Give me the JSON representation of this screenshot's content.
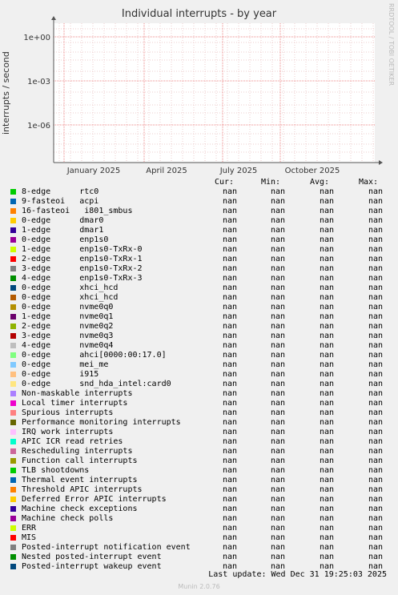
{
  "title": "Individual interrupts - by year",
  "side_label": "RRDTOOL / TOBI OETIKER",
  "footer": "Munin 2.0.76",
  "last_update": "Last update:  Wed Dec 31 19:25:03 2025",
  "columns": [
    "Cur:",
    "Min:",
    "Avg:",
    "Max:"
  ],
  "chart_data": {
    "type": "line",
    "title": "Individual interrupts - by year",
    "ylabel": "interrupts / second",
    "xlabel": "",
    "yscale": "log",
    "yticks": [
      "1e+00",
      "1e-03",
      "1e-06"
    ],
    "xticks": [
      "January 2025",
      "April 2025",
      "July 2025",
      "October 2025"
    ],
    "grid": true,
    "series_values": "nan"
  },
  "series": [
    {
      "label": "8-edge      rtc0",
      "color": "#00cc00",
      "cur": "nan",
      "min": "nan",
      "avg": "nan",
      "max": "nan"
    },
    {
      "label": "9-fasteoi   acpi",
      "color": "#0066b3",
      "cur": "nan",
      "min": "nan",
      "avg": "nan",
      "max": "nan"
    },
    {
      "label": "16-fasteoi   i801_smbus",
      "color": "#ff8000",
      "cur": "nan",
      "min": "nan",
      "avg": "nan",
      "max": "nan"
    },
    {
      "label": "0-edge      dmar0",
      "color": "#ffcc00",
      "cur": "nan",
      "min": "nan",
      "avg": "nan",
      "max": "nan"
    },
    {
      "label": "1-edge      dmar1",
      "color": "#330099",
      "cur": "nan",
      "min": "nan",
      "avg": "nan",
      "max": "nan"
    },
    {
      "label": "0-edge      enp1s0",
      "color": "#990099",
      "cur": "nan",
      "min": "nan",
      "avg": "nan",
      "max": "nan"
    },
    {
      "label": "1-edge      enp1s0-TxRx-0",
      "color": "#ccff00",
      "cur": "nan",
      "min": "nan",
      "avg": "nan",
      "max": "nan"
    },
    {
      "label": "2-edge      enp1s0-TxRx-1",
      "color": "#ff0000",
      "cur": "nan",
      "min": "nan",
      "avg": "nan",
      "max": "nan"
    },
    {
      "label": "3-edge      enp1s0-TxRx-2",
      "color": "#808080",
      "cur": "nan",
      "min": "nan",
      "avg": "nan",
      "max": "nan"
    },
    {
      "label": "4-edge      enp1s0-TxRx-3",
      "color": "#008f00",
      "cur": "nan",
      "min": "nan",
      "avg": "nan",
      "max": "nan"
    },
    {
      "label": "0-edge      xhci_hcd",
      "color": "#00487d",
      "cur": "nan",
      "min": "nan",
      "avg": "nan",
      "max": "nan"
    },
    {
      "label": "0-edge      xhci_hcd",
      "color": "#b35a00",
      "cur": "nan",
      "min": "nan",
      "avg": "nan",
      "max": "nan"
    },
    {
      "label": "0-edge      nvme0q0",
      "color": "#b38f00",
      "cur": "nan",
      "min": "nan",
      "avg": "nan",
      "max": "nan"
    },
    {
      "label": "1-edge      nvme0q1",
      "color": "#6b006b",
      "cur": "nan",
      "min": "nan",
      "avg": "nan",
      "max": "nan"
    },
    {
      "label": "2-edge      nvme0q2",
      "color": "#8fb300",
      "cur": "nan",
      "min": "nan",
      "avg": "nan",
      "max": "nan"
    },
    {
      "label": "3-edge      nvme0q3",
      "color": "#b30000",
      "cur": "nan",
      "min": "nan",
      "avg": "nan",
      "max": "nan"
    },
    {
      "label": "4-edge      nvme0q4",
      "color": "#bebebe",
      "cur": "nan",
      "min": "nan",
      "avg": "nan",
      "max": "nan"
    },
    {
      "label": "0-edge      ahci[0000:00:17.0]",
      "color": "#80ff80",
      "cur": "nan",
      "min": "nan",
      "avg": "nan",
      "max": "nan"
    },
    {
      "label": "0-edge      mei_me",
      "color": "#80c9ff",
      "cur": "nan",
      "min": "nan",
      "avg": "nan",
      "max": "nan"
    },
    {
      "label": "0-edge      i915",
      "color": "#ffc080",
      "cur": "nan",
      "min": "nan",
      "avg": "nan",
      "max": "nan"
    },
    {
      "label": "0-edge      snd_hda_intel:card0",
      "color": "#ffe680",
      "cur": "nan",
      "min": "nan",
      "avg": "nan",
      "max": "nan"
    },
    {
      "label": "Non-maskable interrupts",
      "color": "#aa80ff",
      "cur": "nan",
      "min": "nan",
      "avg": "nan",
      "max": "nan"
    },
    {
      "label": "Local timer interrupts",
      "color": "#ee00cc",
      "cur": "nan",
      "min": "nan",
      "avg": "nan",
      "max": "nan"
    },
    {
      "label": "Spurious interrupts",
      "color": "#ff8080",
      "cur": "nan",
      "min": "nan",
      "avg": "nan",
      "max": "nan"
    },
    {
      "label": "Performance monitoring interrupts",
      "color": "#666600",
      "cur": "nan",
      "min": "nan",
      "avg": "nan",
      "max": "nan"
    },
    {
      "label": "IRQ work interrupts",
      "color": "#ffbfff",
      "cur": "nan",
      "min": "nan",
      "avg": "nan",
      "max": "nan"
    },
    {
      "label": "APIC ICR read retries",
      "color": "#00ffcc",
      "cur": "nan",
      "min": "nan",
      "avg": "nan",
      "max": "nan"
    },
    {
      "label": "Rescheduling interrupts",
      "color": "#cc6699",
      "cur": "nan",
      "min": "nan",
      "avg": "nan",
      "max": "nan"
    },
    {
      "label": "Function call interrupts",
      "color": "#999900",
      "cur": "nan",
      "min": "nan",
      "avg": "nan",
      "max": "nan"
    },
    {
      "label": "TLB shootdowns",
      "color": "#00cc00",
      "cur": "nan",
      "min": "nan",
      "avg": "nan",
      "max": "nan"
    },
    {
      "label": "Thermal event interrupts",
      "color": "#0066b3",
      "cur": "nan",
      "min": "nan",
      "avg": "nan",
      "max": "nan"
    },
    {
      "label": "Threshold APIC interrupts",
      "color": "#ff8000",
      "cur": "nan",
      "min": "nan",
      "avg": "nan",
      "max": "nan"
    },
    {
      "label": "Deferred Error APIC interrupts",
      "color": "#ffcc00",
      "cur": "nan",
      "min": "nan",
      "avg": "nan",
      "max": "nan"
    },
    {
      "label": "Machine check exceptions",
      "color": "#330099",
      "cur": "nan",
      "min": "nan",
      "avg": "nan",
      "max": "nan"
    },
    {
      "label": "Machine check polls",
      "color": "#990099",
      "cur": "nan",
      "min": "nan",
      "avg": "nan",
      "max": "nan"
    },
    {
      "label": "ERR",
      "color": "#ccff00",
      "cur": "nan",
      "min": "nan",
      "avg": "nan",
      "max": "nan"
    },
    {
      "label": "MIS",
      "color": "#ff0000",
      "cur": "nan",
      "min": "nan",
      "avg": "nan",
      "max": "nan"
    },
    {
      "label": "Posted-interrupt notification event",
      "color": "#808080",
      "cur": "nan",
      "min": "nan",
      "avg": "nan",
      "max": "nan"
    },
    {
      "label": "Nested posted-interrupt event",
      "color": "#008f00",
      "cur": "nan",
      "min": "nan",
      "avg": "nan",
      "max": "nan"
    },
    {
      "label": "Posted-interrupt wakeup event",
      "color": "#00487d",
      "cur": "nan",
      "min": "nan",
      "avg": "nan",
      "max": "nan"
    }
  ]
}
